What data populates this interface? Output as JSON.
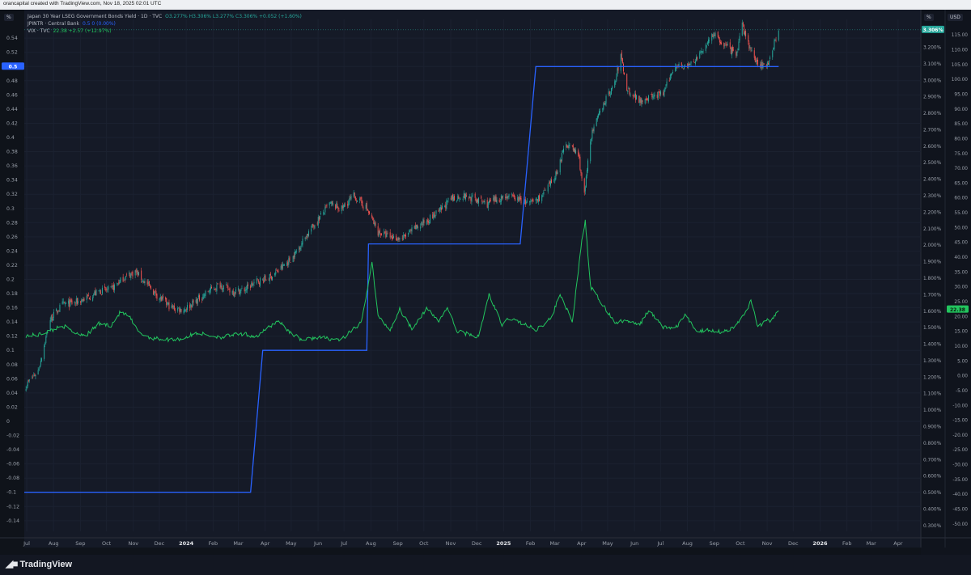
{
  "header": {
    "credit": "orancapital created with TradingView.com, Nov 18, 2025 02:01 UTC"
  },
  "legend": [
    {
      "name": "Japan 30 Year LSEG Government Bonds Yield · 1D · TVC",
      "values": "O3.277% H3.306% L3.277% C3.306% +0.052 (+1.60%)",
      "color": "#26a69a"
    },
    {
      "name": "JPINTR · Central Bank",
      "values": "0.5 0 (0.00%)",
      "color": "#2962ff"
    },
    {
      "name": "VIX · TVC",
      "values": "22.38 +2.57 (+12.97%)",
      "color": "#22c55e"
    }
  ],
  "scale_labels": {
    "left_unit": "%",
    "mid_unit": "%",
    "right_unit": "USD",
    "left_badge": "0.5",
    "mid_badge": "3.306%",
    "right_badge": "22.38"
  },
  "footer": {
    "brand": "TradingView",
    "logo_icon": "tradingview-logo-icon"
  },
  "colors": {
    "background": "#0f131a",
    "candle_up": "#26a69a",
    "candle_down": "#ef5350",
    "central_bank": "#2962ff",
    "vix": "#22c55e"
  },
  "chart_data": {
    "type": "line",
    "x_axis": {
      "ticks": [
        "Jul",
        "Aug",
        "Sep",
        "Oct",
        "Nov",
        "Dec",
        "2024",
        "Feb",
        "Mar",
        "Apr",
        "May",
        "Jun",
        "Jul",
        "Aug",
        "Sep",
        "Oct",
        "Nov",
        "Dec",
        "2025",
        "Feb",
        "Mar",
        "Apr",
        "May",
        "Jun",
        "Jul",
        "Aug",
        "Sep",
        "Oct",
        "Nov",
        "Dec",
        "2026",
        "Feb",
        "Mar",
        "Apr"
      ],
      "range": [
        "2023-07-01",
        "2026-04-30"
      ]
    },
    "left_axis": {
      "ticks": [
        "0.54",
        "0.52",
        "0.5",
        "0.48",
        "0.46",
        "0.44",
        "0.42",
        "0.4",
        "0.38",
        "0.36",
        "0.34",
        "0.32",
        "0.3",
        "0.28",
        "0.26",
        "0.24",
        "0.22",
        "0.2",
        "0.18",
        "0.16",
        "0.14",
        "0.12",
        "0.1",
        "0.08",
        "0.06",
        "0.04",
        "0.02",
        "0",
        "-0.02",
        "-0.04",
        "-0.06",
        "-0.08",
        "-0.1",
        "-0.12",
        "-0.14"
      ],
      "range": [
        -0.155,
        0.555
      ]
    },
    "mid_axis": {
      "ticks": [
        "3.200%",
        "3.100%",
        "3.000%",
        "2.900%",
        "2.800%",
        "2.700%",
        "2.600%",
        "2.500%",
        "2.400%",
        "2.300%",
        "2.200%",
        "2.100%",
        "2.000%",
        "1.900%",
        "1.800%",
        "1.700%",
        "1.600%",
        "1.500%",
        "1.400%",
        "1.300%",
        "1.200%",
        "1.100%",
        "1.000%",
        "0.900%",
        "0.800%",
        "0.700%",
        "0.600%",
        "0.500%",
        "0.400%",
        "0.300%"
      ],
      "range": [
        0.265,
        3.32
      ]
    },
    "right_axis": {
      "ticks": [
        "115.00",
        "110.00",
        "105.00",
        "100.00",
        "95.00",
        "90.00",
        "85.00",
        "80.00",
        "75.00",
        "70.00",
        "65.00",
        "60.00",
        "55.00",
        "50.00",
        "45.00",
        "40.00",
        "35.00",
        "30.00",
        "25.00",
        "20.00",
        "15.00",
        "10.00",
        "5.00",
        "0.00",
        "-5.00",
        "-10.00",
        "-15.00",
        "-20.00",
        "-25.00",
        "-30.00",
        "-35.00",
        "-40.00",
        "-45.00",
        "-50.00"
      ],
      "range": [
        -52.5,
        117.5
      ]
    },
    "series": [
      {
        "name": "Japan 30 Year LSEG Government Bonds Yield",
        "kind": "candles",
        "axis": "mid",
        "points": [
          [
            "2023-07-03",
            1.15
          ],
          [
            "2023-07-17",
            1.24
          ],
          [
            "2023-07-31",
            1.55
          ],
          [
            "2023-08-14",
            1.64
          ],
          [
            "2023-08-28",
            1.65
          ],
          [
            "2023-09-11",
            1.68
          ],
          [
            "2023-09-25",
            1.72
          ],
          [
            "2023-10-09",
            1.73
          ],
          [
            "2023-10-23",
            1.8
          ],
          [
            "2023-11-06",
            1.84
          ],
          [
            "2023-11-20",
            1.76
          ],
          [
            "2023-12-04",
            1.68
          ],
          [
            "2023-12-18",
            1.62
          ],
          [
            "2024-01-01",
            1.61
          ],
          [
            "2024-01-15",
            1.66
          ],
          [
            "2024-01-29",
            1.72
          ],
          [
            "2024-02-12",
            1.76
          ],
          [
            "2024-02-26",
            1.72
          ],
          [
            "2024-03-11",
            1.73
          ],
          [
            "2024-03-25",
            1.78
          ],
          [
            "2024-04-08",
            1.8
          ],
          [
            "2024-04-22",
            1.86
          ],
          [
            "2024-05-06",
            1.93
          ],
          [
            "2024-05-20",
            2.05
          ],
          [
            "2024-06-03",
            2.15
          ],
          [
            "2024-06-17",
            2.25
          ],
          [
            "2024-07-01",
            2.22
          ],
          [
            "2024-07-15",
            2.3
          ],
          [
            "2024-07-29",
            2.23
          ],
          [
            "2024-08-12",
            2.08
          ],
          [
            "2024-08-26",
            2.05
          ],
          [
            "2024-09-09",
            2.04
          ],
          [
            "2024-09-23",
            2.1
          ],
          [
            "2024-10-07",
            2.15
          ],
          [
            "2024-10-21",
            2.2
          ],
          [
            "2024-11-04",
            2.28
          ],
          [
            "2024-11-18",
            2.3
          ],
          [
            "2024-12-02",
            2.28
          ],
          [
            "2024-12-16",
            2.25
          ],
          [
            "2025-01-06",
            2.3
          ],
          [
            "2025-01-20",
            2.28
          ],
          [
            "2025-02-03",
            2.25
          ],
          [
            "2025-02-17",
            2.3
          ],
          [
            "2025-03-03",
            2.4
          ],
          [
            "2025-03-17",
            2.62
          ],
          [
            "2025-03-31",
            2.55
          ],
          [
            "2025-04-07",
            2.3
          ],
          [
            "2025-04-14",
            2.65
          ],
          [
            "2025-04-28",
            2.85
          ],
          [
            "2025-05-12",
            2.98
          ],
          [
            "2025-05-19",
            3.15
          ],
          [
            "2025-05-26",
            2.95
          ],
          [
            "2025-06-09",
            2.88
          ],
          [
            "2025-06-23",
            2.9
          ],
          [
            "2025-07-07",
            2.92
          ],
          [
            "2025-07-21",
            3.1
          ],
          [
            "2025-08-04",
            3.08
          ],
          [
            "2025-08-18",
            3.15
          ],
          [
            "2025-09-01",
            3.28
          ],
          [
            "2025-09-15",
            3.22
          ],
          [
            "2025-09-29",
            3.15
          ],
          [
            "2025-10-06",
            3.33
          ],
          [
            "2025-10-20",
            3.12
          ],
          [
            "2025-11-03",
            3.08
          ],
          [
            "2025-11-17",
            3.306
          ]
        ]
      },
      {
        "name": "JPINTR",
        "kind": "line",
        "axis": "left",
        "points": [
          [
            "2023-07-01",
            -0.1
          ],
          [
            "2024-03-18",
            -0.1
          ],
          [
            "2024-04-01",
            0.1
          ],
          [
            "2024-07-30",
            0.1
          ],
          [
            "2024-08-01",
            0.25
          ],
          [
            "2025-01-23",
            0.25
          ],
          [
            "2025-02-10",
            0.5
          ],
          [
            "2025-11-17",
            0.5
          ]
        ]
      },
      {
        "name": "VIX",
        "kind": "line",
        "axis": "right",
        "points": [
          [
            "2023-07-03",
            13.5
          ],
          [
            "2023-07-17",
            13.8
          ],
          [
            "2023-08-03",
            15.5
          ],
          [
            "2023-08-14",
            17.0
          ],
          [
            "2023-08-28",
            14.5
          ],
          [
            "2023-09-11",
            13.8
          ],
          [
            "2023-09-25",
            17.5
          ],
          [
            "2023-10-09",
            17.0
          ],
          [
            "2023-10-20",
            21.5
          ],
          [
            "2023-10-30",
            20.0
          ],
          [
            "2023-11-10",
            14.5
          ],
          [
            "2023-11-24",
            12.8
          ],
          [
            "2023-12-11",
            12.2
          ],
          [
            "2023-12-29",
            12.4
          ],
          [
            "2024-01-17",
            14.5
          ],
          [
            "2024-01-31",
            13.5
          ],
          [
            "2024-02-14",
            13.0
          ],
          [
            "2024-02-26",
            13.8
          ],
          [
            "2024-03-11",
            14.0
          ],
          [
            "2024-03-25",
            13.2
          ],
          [
            "2024-04-19",
            18.7
          ],
          [
            "2024-05-03",
            14.5
          ],
          [
            "2024-05-17",
            12.0
          ],
          [
            "2024-06-03",
            13.0
          ],
          [
            "2024-06-17",
            12.5
          ],
          [
            "2024-07-01",
            12.2
          ],
          [
            "2024-07-24",
            18.0
          ],
          [
            "2024-08-05",
            38.5
          ],
          [
            "2024-08-12",
            20.0
          ],
          [
            "2024-08-26",
            15.5
          ],
          [
            "2024-09-06",
            22.4
          ],
          [
            "2024-09-20",
            16.0
          ],
          [
            "2024-10-07",
            22.6
          ],
          [
            "2024-10-21",
            18.5
          ],
          [
            "2024-10-31",
            23.0
          ],
          [
            "2024-11-11",
            15.0
          ],
          [
            "2024-11-25",
            14.0
          ],
          [
            "2024-12-06",
            13.0
          ],
          [
            "2024-12-18",
            27.5
          ],
          [
            "2025-01-02",
            17.0
          ],
          [
            "2025-01-10",
            19.5
          ],
          [
            "2025-01-27",
            17.5
          ],
          [
            "2025-02-10",
            15.5
          ],
          [
            "2025-02-28",
            19.5
          ],
          [
            "2025-03-10",
            27.8
          ],
          [
            "2025-03-24",
            18.0
          ],
          [
            "2025-04-04",
            45.3
          ],
          [
            "2025-04-08",
            52.3
          ],
          [
            "2025-04-14",
            30.0
          ],
          [
            "2025-04-28",
            24.0
          ],
          [
            "2025-05-12",
            18.0
          ],
          [
            "2025-05-26",
            18.5
          ],
          [
            "2025-06-09",
            17.0
          ],
          [
            "2025-06-20",
            22.0
          ],
          [
            "2025-07-07",
            16.5
          ],
          [
            "2025-07-21",
            16.0
          ],
          [
            "2025-08-01",
            20.4
          ],
          [
            "2025-08-15",
            15.0
          ],
          [
            "2025-08-29",
            15.5
          ],
          [
            "2025-09-12",
            14.8
          ],
          [
            "2025-09-26",
            16.0
          ],
          [
            "2025-10-10",
            21.5
          ],
          [
            "2025-10-16",
            25.3
          ],
          [
            "2025-10-24",
            16.5
          ],
          [
            "2025-11-04",
            19.0
          ],
          [
            "2025-11-07",
            17.5
          ],
          [
            "2025-11-17",
            22.38
          ]
        ]
      }
    ]
  }
}
